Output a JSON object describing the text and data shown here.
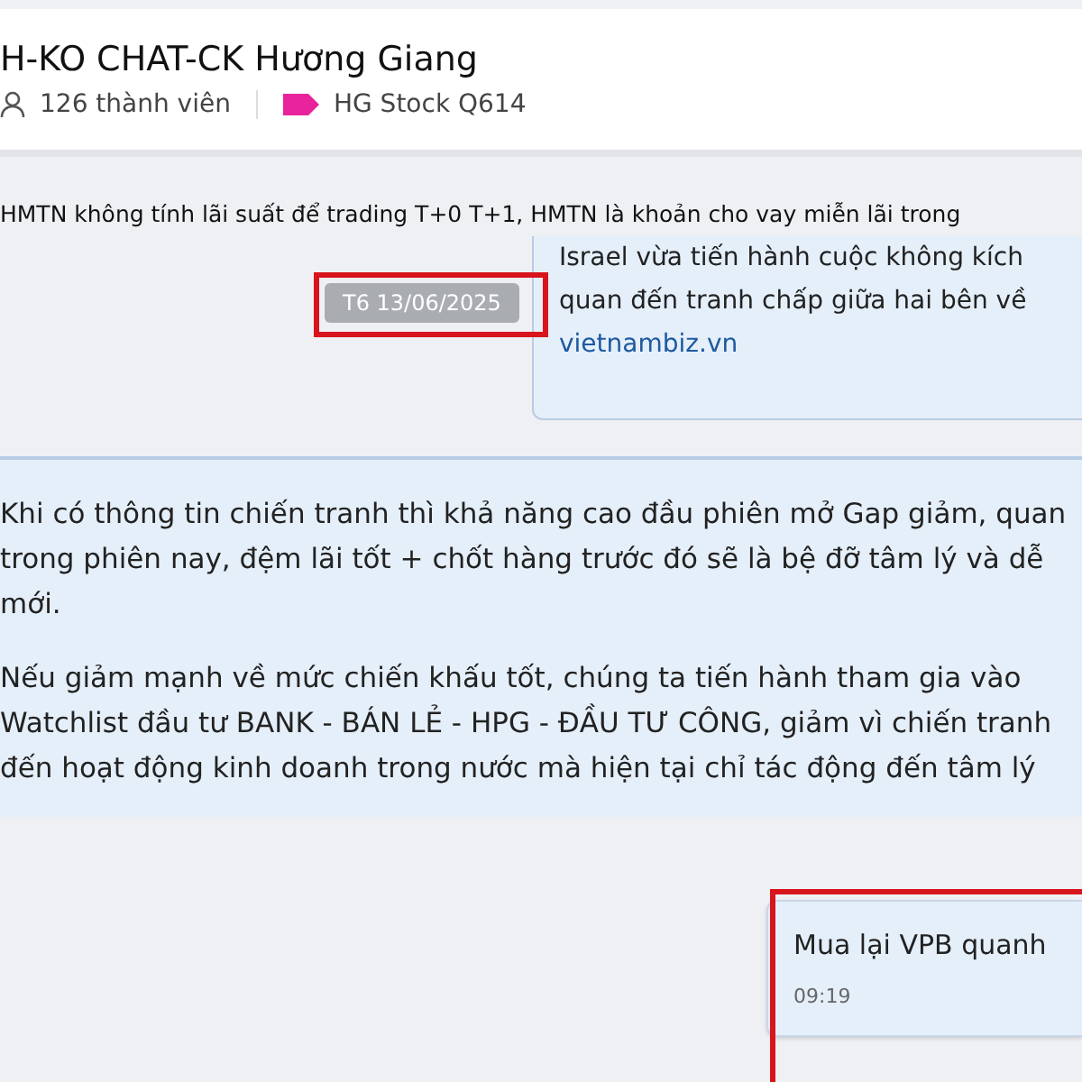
{
  "header": {
    "title": "H-KO CHAT-CK Hương Giang",
    "members": "126 thành viên",
    "tag": {
      "label": "HG Stock Q614",
      "color": "#e8239c"
    }
  },
  "messages": [
    {
      "kind": "text",
      "lines": [
        "HMTN không tính lãi suất để trading T+0 T+1, HMTN là khoản cho vay miễn lãi trong"
      ]
    },
    {
      "kind": "link",
      "lines": [
        "Israel vừa tiến hành cuộc không kích",
        "quan đến tranh chấp giữa hai bên về"
      ],
      "source": "vietnambiz.vn",
      "date": "T6 13/06/2025",
      "highlighted": true
    },
    {
      "kind": "bubble",
      "paragraphs": [
        [
          "Khi có thông tin chiến tranh thì khả năng cao đầu phiên mở Gap giảm, quan",
          "trong phiên nay, đệm lãi tốt + chốt hàng trước đó sẽ là bệ đỡ tâm lý và dễ",
          "mới."
        ],
        [
          "Nếu giảm mạnh về mức chiến khấu tốt, chúng ta tiến hành tham gia vào",
          "Watchlist đầu tư BANK - BÁN LẺ - HPG - ĐẦU TƯ CÔNG, giảm vì chiến tranh",
          "đến hoạt động kinh doanh trong nước mà hiện tại chỉ tác động đến tâm lý"
        ]
      ]
    },
    {
      "kind": "own",
      "lines": [
        "Mua lại VPB quanh"
      ],
      "time": "09:19",
      "highlighted": true
    }
  ]
}
